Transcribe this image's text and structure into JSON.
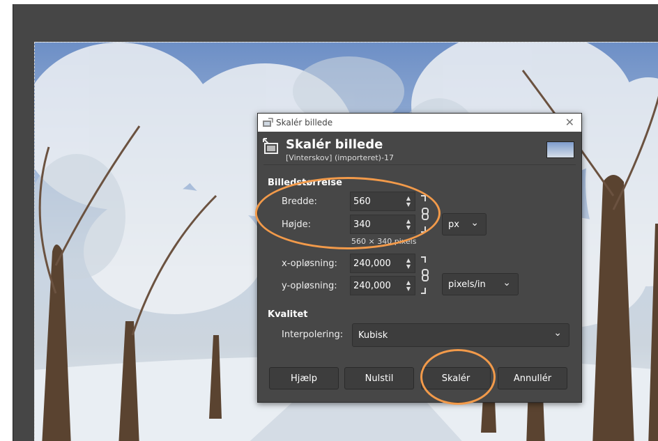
{
  "dialog": {
    "window_title": "Skalér billede",
    "header_title": "Skalér billede",
    "header_subtitle": "[Vinterskov] (importeret)-17",
    "close_glyph": "✕"
  },
  "image_size": {
    "section_label": "Billedstørrelse",
    "width_label": "Bredde:",
    "width_value": "560",
    "height_label": "Højde:",
    "height_value": "340",
    "unit": "px",
    "pixel_summary": "560 × 340 pixels",
    "x_res_label": "x-opløsning:",
    "x_res_value": "240,000",
    "y_res_label": "y-opløsning:",
    "y_res_value": "240,000",
    "res_unit": "pixels/in"
  },
  "quality": {
    "section_label": "Kvalitet",
    "interp_label": "Interpolering:",
    "interp_value": "Kubisk"
  },
  "buttons": {
    "help": "Hjælp",
    "reset": "Nulstil",
    "scale": "Skalér",
    "cancel": "Annullér"
  },
  "colors": {
    "annotation": "#f29a4a",
    "dialog_bg": "#474747",
    "canvas_bg": "#464646"
  },
  "icons": [
    "scale-image-icon",
    "chain-link-icon",
    "chevron-down-icon",
    "close-icon"
  ]
}
